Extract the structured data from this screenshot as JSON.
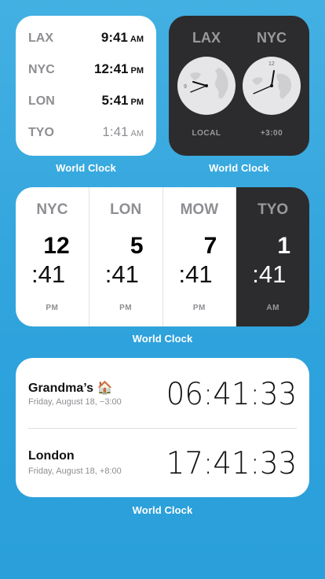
{
  "widget_label": "World Clock",
  "list_widget": {
    "rows": [
      {
        "city": "LAX",
        "time": "9:41",
        "ampm": "AM",
        "dim": false
      },
      {
        "city": "NYC",
        "time": "12:41",
        "ampm": "PM",
        "dim": false
      },
      {
        "city": "LON",
        "time": "5:41",
        "ampm": "PM",
        "dim": false
      },
      {
        "city": "TYO",
        "time": "1:41",
        "ampm": "AM",
        "dim": true
      }
    ]
  },
  "analog_widget": {
    "clocks": [
      {
        "city": "LAX",
        "sub": "LOCAL",
        "hour": 9,
        "minute": 41
      },
      {
        "city": "NYC",
        "sub": "+3:00",
        "hour": 12,
        "minute": 41
      }
    ]
  },
  "columns_widget": {
    "cols": [
      {
        "city": "NYC",
        "hour": "12",
        "min": ":41",
        "ampm": "PM",
        "dark": false
      },
      {
        "city": "LON",
        "hour": "5",
        "min": ":41",
        "ampm": "PM",
        "dark": false
      },
      {
        "city": "MOW",
        "hour": "7",
        "min": ":41",
        "ampm": "PM",
        "dark": false
      },
      {
        "city": "TYO",
        "hour": "1",
        "min": ":41",
        "ampm": "AM",
        "dark": true
      }
    ]
  },
  "digital_widget": {
    "entries": [
      {
        "name": "Grandma’s 🏠",
        "date": "Friday, August 18, −3:00",
        "time": "06:41:33"
      },
      {
        "name": "London",
        "date": "Friday, August 18, +8:00",
        "time": "17:41:33"
      }
    ]
  },
  "colors": {
    "background_top": "#43b0e2",
    "background_bottom": "#2a9fd9",
    "card_light": "#ffffff",
    "card_dark": "#2c2c2e",
    "text_gray": "#8e8e93"
  }
}
